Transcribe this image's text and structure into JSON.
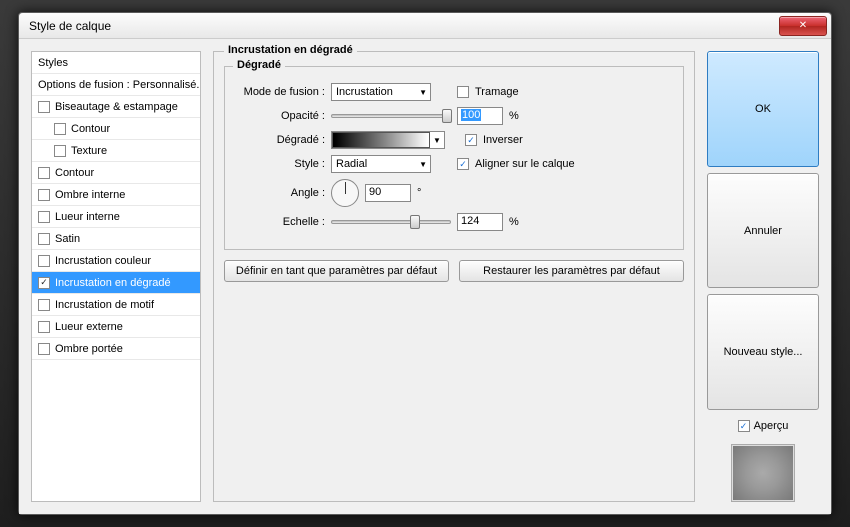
{
  "window": {
    "title": "Style de calque"
  },
  "sidebar": {
    "header": "Styles",
    "blend_options": "Options de fusion : Personnalisé...",
    "items": [
      {
        "label": "Biseautage & estampage",
        "checked": false,
        "indent": false
      },
      {
        "label": "Contour",
        "checked": false,
        "indent": true
      },
      {
        "label": "Texture",
        "checked": false,
        "indent": true
      },
      {
        "label": "Contour",
        "checked": false,
        "indent": false
      },
      {
        "label": "Ombre interne",
        "checked": false,
        "indent": false
      },
      {
        "label": "Lueur interne",
        "checked": false,
        "indent": false
      },
      {
        "label": "Satin",
        "checked": false,
        "indent": false
      },
      {
        "label": "Incrustation couleur",
        "checked": false,
        "indent": false
      },
      {
        "label": "Incrustation en dégradé",
        "checked": true,
        "indent": false,
        "selected": true
      },
      {
        "label": "Incrustation de motif",
        "checked": false,
        "indent": false
      },
      {
        "label": "Lueur externe",
        "checked": false,
        "indent": false
      },
      {
        "label": "Ombre portée",
        "checked": false,
        "indent": false
      }
    ]
  },
  "panel": {
    "title": "Incrustation en dégradé",
    "group_title": "Dégradé",
    "labels": {
      "blend_mode": "Mode de fusion :",
      "opacity": "Opacité :",
      "gradient": "Dégradé :",
      "style": "Style :",
      "angle": "Angle :",
      "scale": "Echelle :"
    },
    "values": {
      "blend_mode": "Incrustation",
      "opacity": "100",
      "opacity_unit": "%",
      "style": "Radial",
      "angle": "90",
      "angle_unit": "°",
      "scale": "124",
      "scale_unit": "%"
    },
    "checks": {
      "dither": {
        "label": "Tramage",
        "checked": false
      },
      "reverse": {
        "label": "Inverser",
        "checked": true
      },
      "align": {
        "label": "Aligner sur le calque",
        "checked": true
      }
    },
    "buttons": {
      "make_default": "Définir en tant que paramètres par défaut",
      "reset_default": "Restaurer les paramètres par défaut"
    }
  },
  "right": {
    "ok": "OK",
    "cancel": "Annuler",
    "new_style": "Nouveau style...",
    "preview": {
      "label": "Aperçu",
      "checked": true
    }
  }
}
